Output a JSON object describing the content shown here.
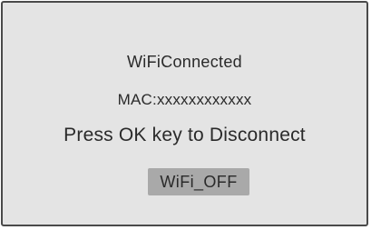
{
  "screen": {
    "status_text": "WiFiConnected",
    "mac_text": "MAC:xxxxxxxxxxxx",
    "instruction_text": "Press OK key to Disconnect",
    "button_label": "WiFi_OFF"
  }
}
